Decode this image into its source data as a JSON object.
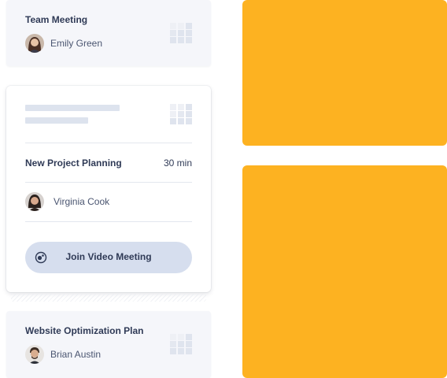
{
  "cards": {
    "top": {
      "title": "Team Meeting",
      "person": "Emily Green",
      "icon": "grid-chart-icon"
    },
    "main": {
      "meeting_title": "New Project Planning",
      "duration": "30 min",
      "person": "Virginia Cook",
      "join_button": "Join Video Meeting",
      "join_icon": "video-call-icon"
    },
    "bottom": {
      "title": "Website Optimization Plan",
      "person": "Brian Austin",
      "icon": "grid-chart-icon"
    }
  },
  "colors": {
    "accent_orange": "#fdb221",
    "button_bg": "#d6deee",
    "text_dark": "#2f3a56"
  }
}
